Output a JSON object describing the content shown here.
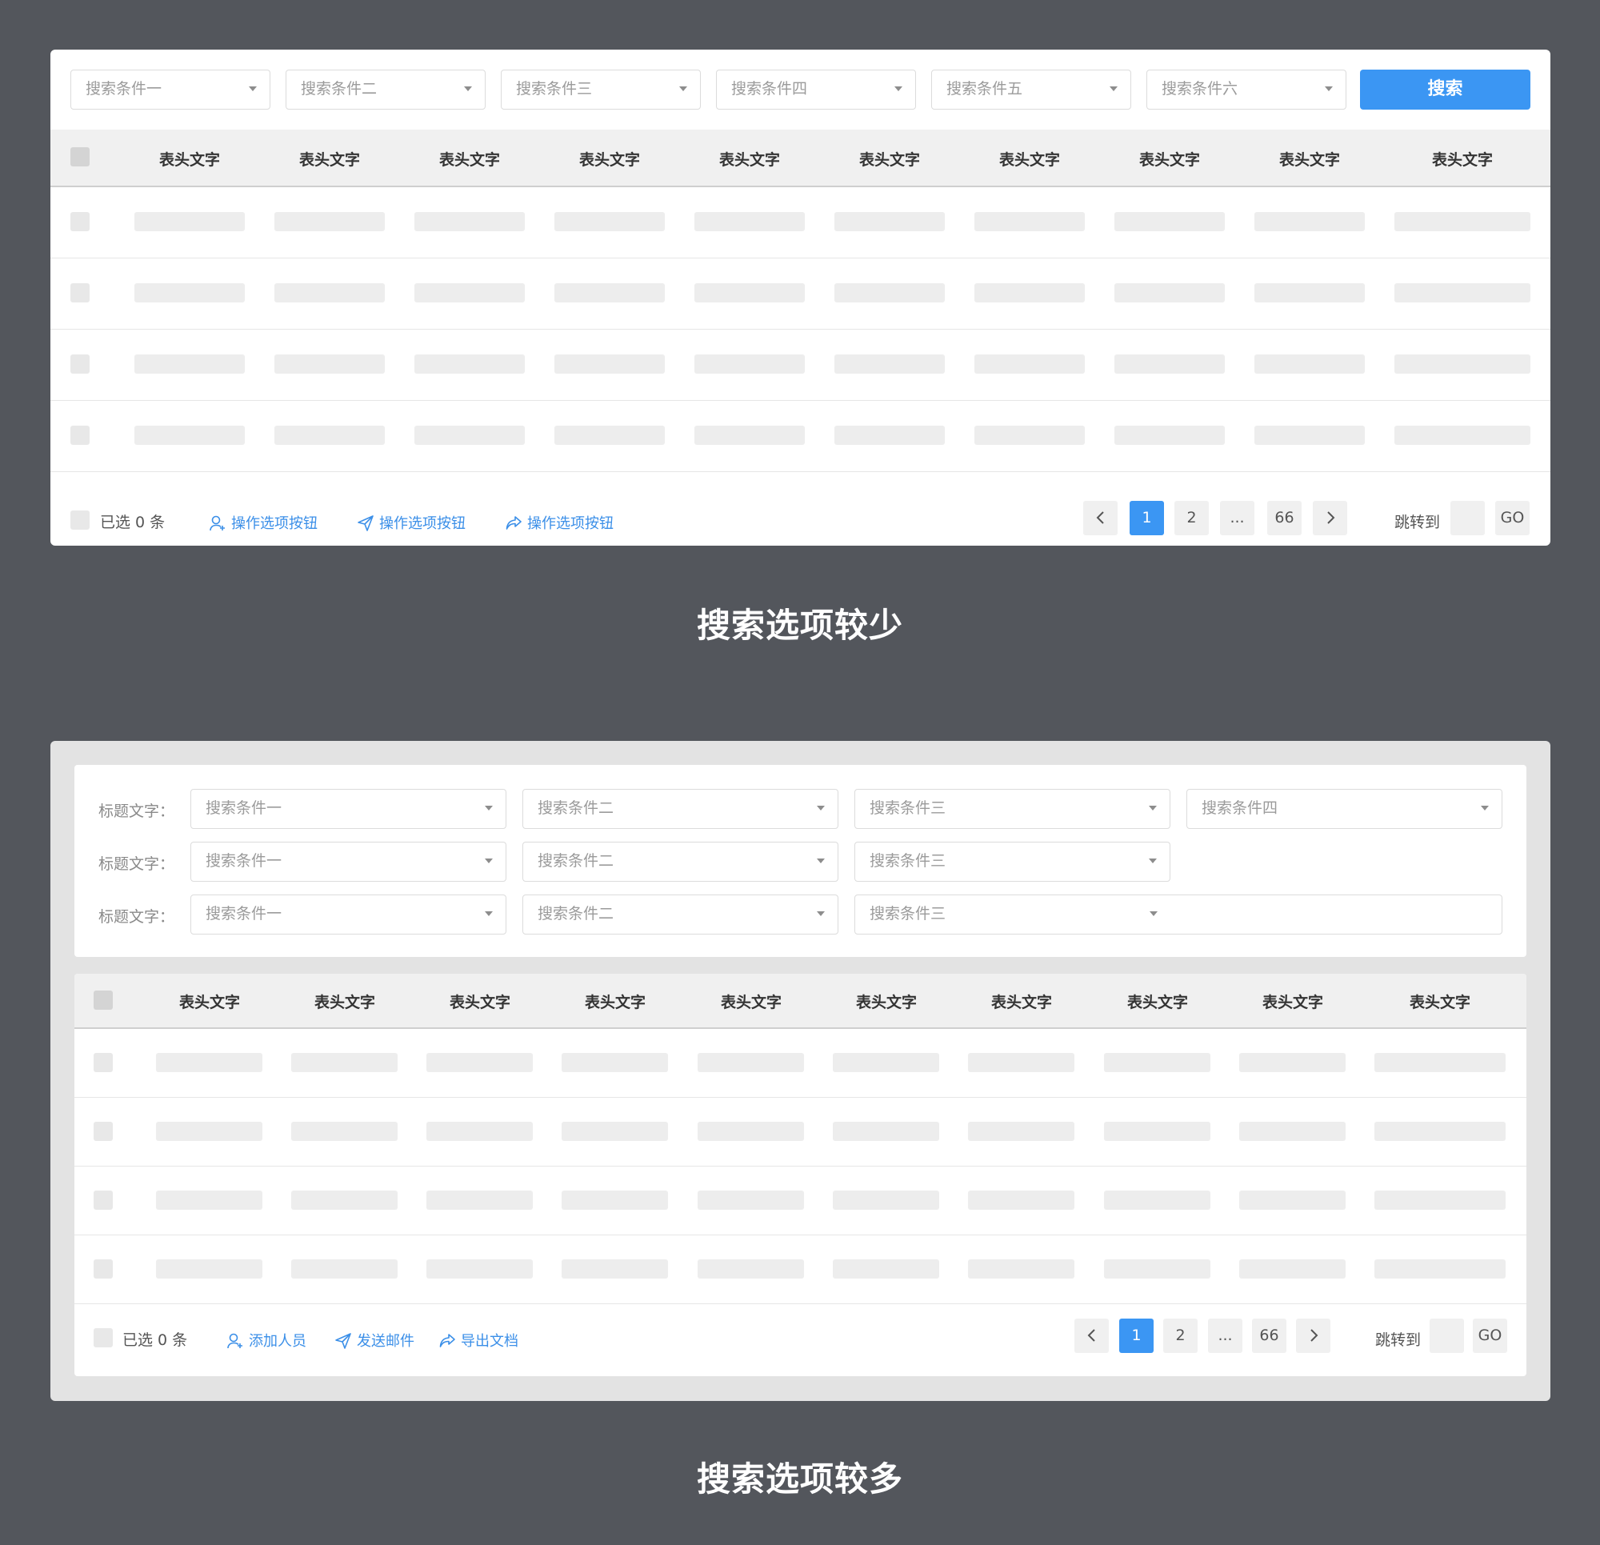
{
  "section1": {
    "caption": "搜索选项较少",
    "filters": [
      "搜索条件一",
      "搜索条件二",
      "搜索条件三",
      "搜索条件四",
      "搜索条件五",
      "搜索条件六"
    ],
    "search_button": "搜索",
    "columns": [
      "表头文字",
      "表头文字",
      "表头文字",
      "表头文字",
      "表头文字",
      "表头文字",
      "表头文字",
      "表头文字",
      "表头文字",
      "表头文字"
    ],
    "selected_text": "已选 0 条",
    "actions": [
      {
        "label": "操作选项按钮",
        "icon": "add-user-icon"
      },
      {
        "label": "操作选项按钮",
        "icon": "send-icon"
      },
      {
        "label": "操作选项按钮",
        "icon": "share-icon"
      }
    ],
    "pagination": {
      "pages": [
        "1",
        "2",
        "...",
        "66"
      ],
      "current": "1",
      "jump_label": "跳转到",
      "go": "GO"
    }
  },
  "section2": {
    "caption": "搜索选项较多",
    "filter_label": "标题文字：",
    "filter_rows": [
      [
        "搜索条件一",
        "搜索条件二",
        "搜索条件三",
        "搜索条件四"
      ],
      [
        "搜索条件一",
        "搜索条件二",
        "搜索条件三"
      ],
      [
        "搜索条件一",
        "搜索条件二",
        "搜索条件三"
      ]
    ],
    "columns": [
      "表头文字",
      "表头文字",
      "表头文字",
      "表头文字",
      "表头文字",
      "表头文字",
      "表头文字",
      "表头文字",
      "表头文字",
      "表头文字"
    ],
    "selected_text": "已选 0 条",
    "actions": [
      {
        "label": "添加人员",
        "icon": "add-user-icon"
      },
      {
        "label": "发送邮件",
        "icon": "send-icon"
      },
      {
        "label": "导出文档",
        "icon": "share-icon"
      }
    ],
    "pagination": {
      "pages": [
        "1",
        "2",
        "...",
        "66"
      ],
      "current": "1",
      "jump_label": "跳转到",
      "go": "GO"
    }
  },
  "colors": {
    "background": "#53565c",
    "accent": "#3b96f3",
    "link": "#3b8fe8",
    "panel2_bg": "#e3e3e3"
  }
}
